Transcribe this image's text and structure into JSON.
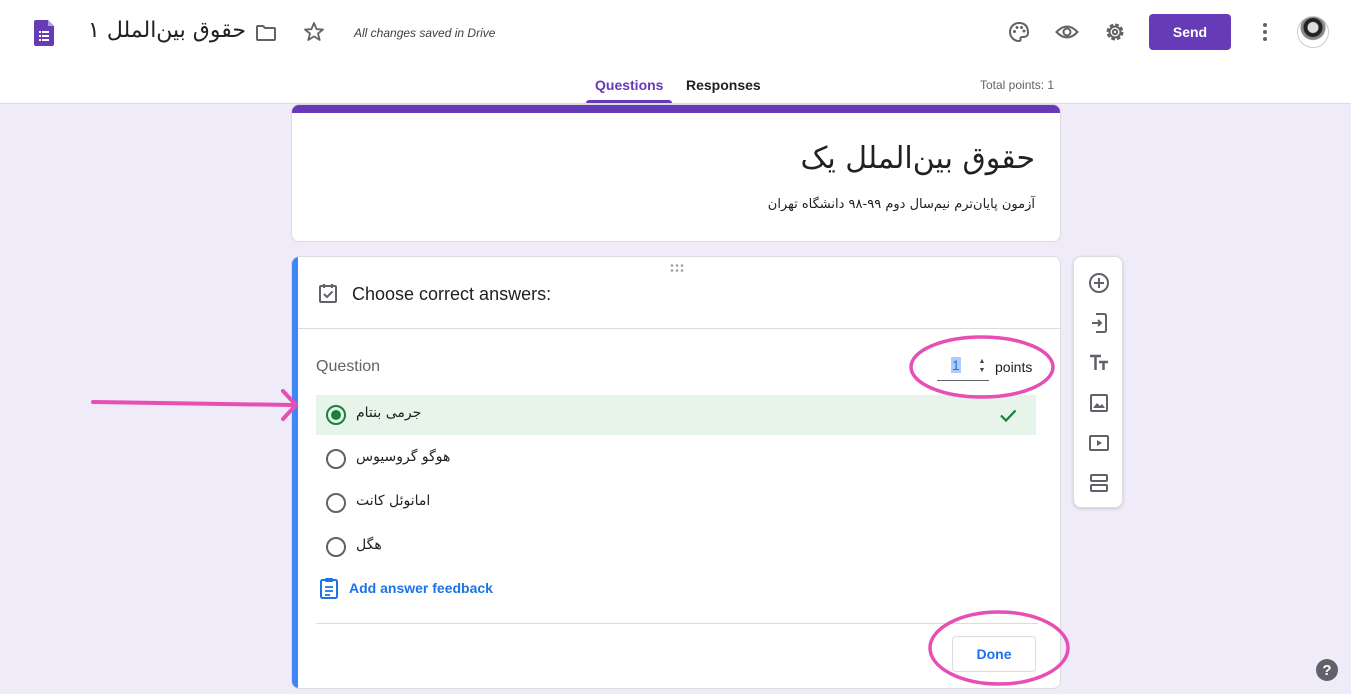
{
  "header": {
    "doc_title": "حقوق بین‌الملل ۱",
    "save_status": "All changes saved in Drive",
    "send_label": "Send",
    "icons": [
      "forms-logo-icon",
      "folder-icon",
      "star-icon",
      "palette-icon",
      "preview-eye-icon",
      "settings-gear-icon",
      "more-vert-icon"
    ]
  },
  "tabs": [
    {
      "label": "Questions",
      "active": true
    },
    {
      "label": "Responses",
      "active": false
    }
  ],
  "total_points": "Total points: 1",
  "form": {
    "title": "حقوق بین‌الملل یک",
    "description": "آزمون پایان‌ترم نیم‌سال دوم ۹۹-۹۸ دانشگاه تهران"
  },
  "question": {
    "choose_label": "Choose correct answers:",
    "question_label": "Question",
    "points_value": "1",
    "points_label": "points",
    "options": [
      {
        "text": "جرمی بنتام",
        "correct": true
      },
      {
        "text": "هوگو گروسیوس",
        "correct": false
      },
      {
        "text": "امانوئل کانت",
        "correct": false
      },
      {
        "text": "هگل",
        "correct": false
      }
    ],
    "feedback_label": "Add answer feedback",
    "done_label": "Done"
  },
  "toolbar": {
    "buttons": [
      "add-question-icon",
      "import-questions-icon",
      "add-title-icon",
      "add-image-icon",
      "add-video-icon",
      "add-section-icon"
    ]
  },
  "help": "?",
  "colors": {
    "accent": "#673ab7",
    "background": "#f0ebf8",
    "correct_bg": "#e6f4ea",
    "correct_green": "#188038",
    "link_blue": "#1a73e8",
    "annotation_pink": "#e64fb4"
  }
}
